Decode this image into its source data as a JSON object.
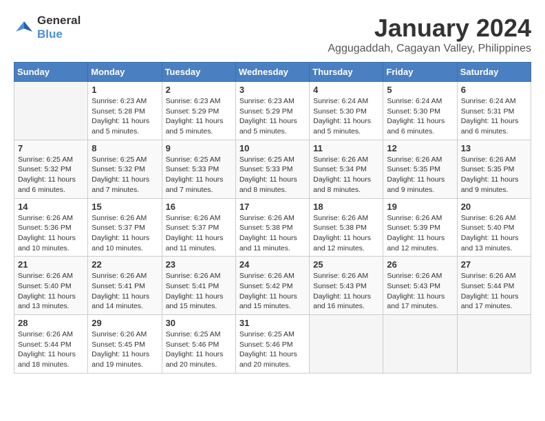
{
  "logo": {
    "line1": "General",
    "line2": "Blue"
  },
  "title": "January 2024",
  "subtitle": "Aggugaddah, Cagayan Valley, Philippines",
  "headers": [
    "Sunday",
    "Monday",
    "Tuesday",
    "Wednesday",
    "Thursday",
    "Friday",
    "Saturday"
  ],
  "weeks": [
    [
      {
        "day": "",
        "info": ""
      },
      {
        "day": "1",
        "info": "Sunrise: 6:23 AM\nSunset: 5:28 PM\nDaylight: 11 hours\nand 5 minutes."
      },
      {
        "day": "2",
        "info": "Sunrise: 6:23 AM\nSunset: 5:29 PM\nDaylight: 11 hours\nand 5 minutes."
      },
      {
        "day": "3",
        "info": "Sunrise: 6:23 AM\nSunset: 5:29 PM\nDaylight: 11 hours\nand 5 minutes."
      },
      {
        "day": "4",
        "info": "Sunrise: 6:24 AM\nSunset: 5:30 PM\nDaylight: 11 hours\nand 5 minutes."
      },
      {
        "day": "5",
        "info": "Sunrise: 6:24 AM\nSunset: 5:30 PM\nDaylight: 11 hours\nand 6 minutes."
      },
      {
        "day": "6",
        "info": "Sunrise: 6:24 AM\nSunset: 5:31 PM\nDaylight: 11 hours\nand 6 minutes."
      }
    ],
    [
      {
        "day": "7",
        "info": "Sunrise: 6:25 AM\nSunset: 5:32 PM\nDaylight: 11 hours\nand 6 minutes."
      },
      {
        "day": "8",
        "info": "Sunrise: 6:25 AM\nSunset: 5:32 PM\nDaylight: 11 hours\nand 7 minutes."
      },
      {
        "day": "9",
        "info": "Sunrise: 6:25 AM\nSunset: 5:33 PM\nDaylight: 11 hours\nand 7 minutes."
      },
      {
        "day": "10",
        "info": "Sunrise: 6:25 AM\nSunset: 5:33 PM\nDaylight: 11 hours\nand 8 minutes."
      },
      {
        "day": "11",
        "info": "Sunrise: 6:26 AM\nSunset: 5:34 PM\nDaylight: 11 hours\nand 8 minutes."
      },
      {
        "day": "12",
        "info": "Sunrise: 6:26 AM\nSunset: 5:35 PM\nDaylight: 11 hours\nand 9 minutes."
      },
      {
        "day": "13",
        "info": "Sunrise: 6:26 AM\nSunset: 5:35 PM\nDaylight: 11 hours\nand 9 minutes."
      }
    ],
    [
      {
        "day": "14",
        "info": "Sunrise: 6:26 AM\nSunset: 5:36 PM\nDaylight: 11 hours\nand 10 minutes."
      },
      {
        "day": "15",
        "info": "Sunrise: 6:26 AM\nSunset: 5:37 PM\nDaylight: 11 hours\nand 10 minutes."
      },
      {
        "day": "16",
        "info": "Sunrise: 6:26 AM\nSunset: 5:37 PM\nDaylight: 11 hours\nand 11 minutes."
      },
      {
        "day": "17",
        "info": "Sunrise: 6:26 AM\nSunset: 5:38 PM\nDaylight: 11 hours\nand 11 minutes."
      },
      {
        "day": "18",
        "info": "Sunrise: 6:26 AM\nSunset: 5:38 PM\nDaylight: 11 hours\nand 12 minutes."
      },
      {
        "day": "19",
        "info": "Sunrise: 6:26 AM\nSunset: 5:39 PM\nDaylight: 11 hours\nand 12 minutes."
      },
      {
        "day": "20",
        "info": "Sunrise: 6:26 AM\nSunset: 5:40 PM\nDaylight: 11 hours\nand 13 minutes."
      }
    ],
    [
      {
        "day": "21",
        "info": "Sunrise: 6:26 AM\nSunset: 5:40 PM\nDaylight: 11 hours\nand 13 minutes."
      },
      {
        "day": "22",
        "info": "Sunrise: 6:26 AM\nSunset: 5:41 PM\nDaylight: 11 hours\nand 14 minutes."
      },
      {
        "day": "23",
        "info": "Sunrise: 6:26 AM\nSunset: 5:41 PM\nDaylight: 11 hours\nand 15 minutes."
      },
      {
        "day": "24",
        "info": "Sunrise: 6:26 AM\nSunset: 5:42 PM\nDaylight: 11 hours\nand 15 minutes."
      },
      {
        "day": "25",
        "info": "Sunrise: 6:26 AM\nSunset: 5:43 PM\nDaylight: 11 hours\nand 16 minutes."
      },
      {
        "day": "26",
        "info": "Sunrise: 6:26 AM\nSunset: 5:43 PM\nDaylight: 11 hours\nand 17 minutes."
      },
      {
        "day": "27",
        "info": "Sunrise: 6:26 AM\nSunset: 5:44 PM\nDaylight: 11 hours\nand 17 minutes."
      }
    ],
    [
      {
        "day": "28",
        "info": "Sunrise: 6:26 AM\nSunset: 5:44 PM\nDaylight: 11 hours\nand 18 minutes."
      },
      {
        "day": "29",
        "info": "Sunrise: 6:26 AM\nSunset: 5:45 PM\nDaylight: 11 hours\nand 19 minutes."
      },
      {
        "day": "30",
        "info": "Sunrise: 6:25 AM\nSunset: 5:46 PM\nDaylight: 11 hours\nand 20 minutes."
      },
      {
        "day": "31",
        "info": "Sunrise: 6:25 AM\nSunset: 5:46 PM\nDaylight: 11 hours\nand 20 minutes."
      },
      {
        "day": "",
        "info": ""
      },
      {
        "day": "",
        "info": ""
      },
      {
        "day": "",
        "info": ""
      }
    ]
  ]
}
